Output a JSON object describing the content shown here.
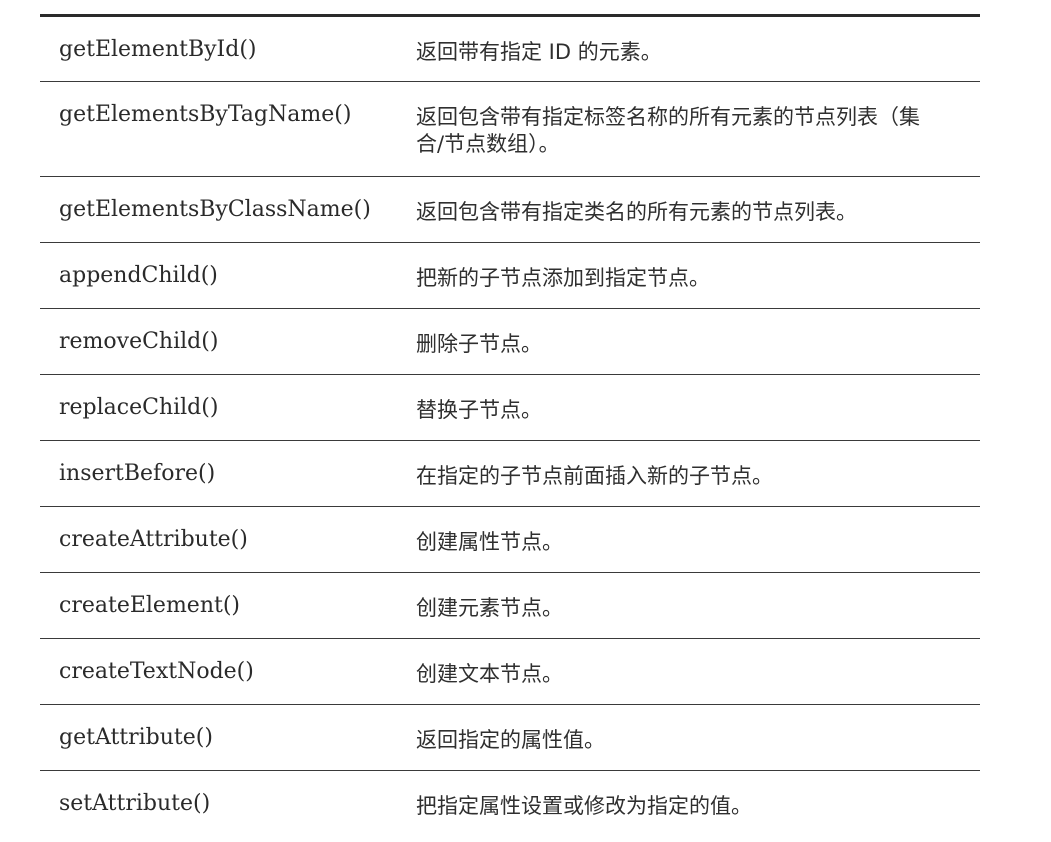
{
  "rows": [
    {
      "method": "getElementById()",
      "description": "返回带有指定 ID 的元素。"
    },
    {
      "method": "getElementsByTagName()",
      "description": "返回包含带有指定标签名称的所有元素的节点列表（集合/节点数组）。"
    },
    {
      "method": "getElementsByClassName()",
      "description": "返回包含带有指定类名的所有元素的节点列表。"
    },
    {
      "method": "appendChild()",
      "description": "把新的子节点添加到指定节点。"
    },
    {
      "method": "removeChild()",
      "description": "删除子节点。"
    },
    {
      "method": "replaceChild()",
      "description": "替换子节点。"
    },
    {
      "method": "insertBefore()",
      "description": "在指定的子节点前面插入新的子节点。"
    },
    {
      "method": "createAttribute()",
      "description": "创建属性节点。"
    },
    {
      "method": "createElement()",
      "description": "创建元素节点。"
    },
    {
      "method": "createTextNode()",
      "description": "创建文本节点。"
    },
    {
      "method": "getAttribute()",
      "description": "返回指定的属性值。"
    },
    {
      "method": "setAttribute()",
      "description": "把指定属性设置或修改为指定的值。"
    }
  ]
}
